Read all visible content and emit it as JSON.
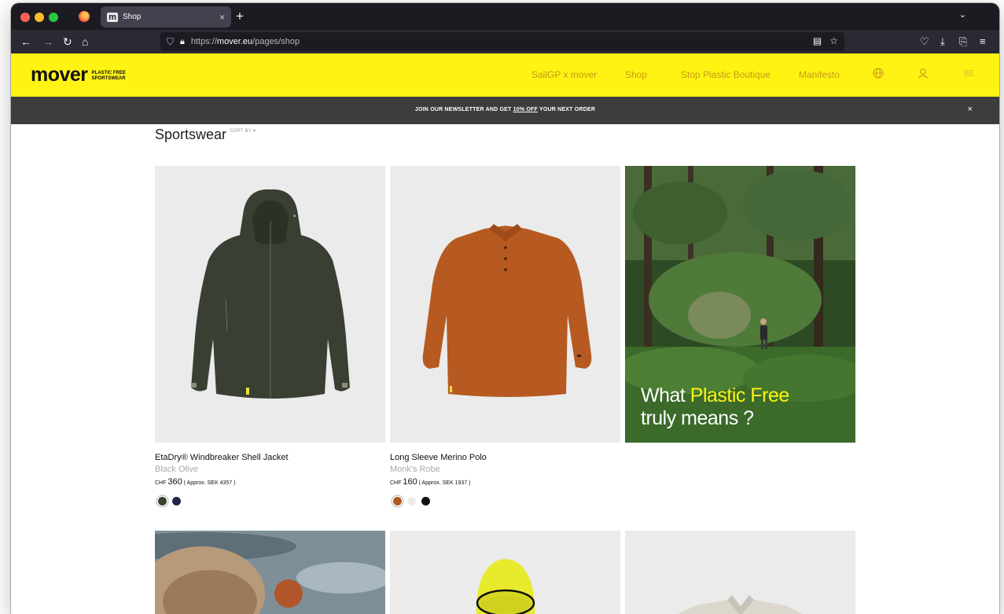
{
  "browser": {
    "tab_title": "Shop",
    "tab_favicon": "m",
    "tab_close": "×",
    "new_tab": "+",
    "tab_list": "⌄",
    "url_scheme": "https://",
    "url_host": "mover.eu",
    "url_path": "/pages/shop",
    "icons": [
      "back-icon",
      "forward-icon",
      "reload-icon",
      "home-icon",
      "shield-icon",
      "lock-icon",
      "reader-view-icon",
      "bookmark-star-icon",
      "pocket-icon",
      "download-icon",
      "extensions-icon",
      "menu-icon"
    ]
  },
  "site": {
    "brand_color": "#fff314",
    "logo_word": "mover",
    "logo_tag_line1": "PLASTIC FREE",
    "logo_tag_line2": "SPORTSWEAR",
    "nav": [
      "SailGP x mover",
      "Shop",
      "Stop Plastic Boutique",
      "Manifesto"
    ],
    "header_icons": [
      "globe-icon",
      "account-icon",
      "hamburger-icon"
    ]
  },
  "newsletter": {
    "before": "JOIN OUR NEWSLETTER AND GET ",
    "link": "10% OFF",
    "after": " YOUR NEXT ORDER",
    "close": "×"
  },
  "page": {
    "title": "Sportswear",
    "sort_by": "SORT BY ▾"
  },
  "promo": {
    "line1_prefix": "What ",
    "line1_highlight": "Plastic Free",
    "line2": "truly means ?"
  },
  "products": [
    {
      "name": "EtaDry® Windbreaker Shell Jacket",
      "color": "Black Olive",
      "currency": "CHF",
      "price": "360",
      "approx": "( Approx. SEK 4357 )",
      "swatches": [
        "#39412f",
        "#23264a"
      ]
    },
    {
      "name": "Long Sleeve Merino Polo",
      "color": "Monk's Robe",
      "currency": "CHF",
      "price": "160",
      "approx": "( Approx. SEK 1937 )",
      "swatches": [
        "#b05a22",
        "#ececec",
        "#111111"
      ]
    }
  ]
}
